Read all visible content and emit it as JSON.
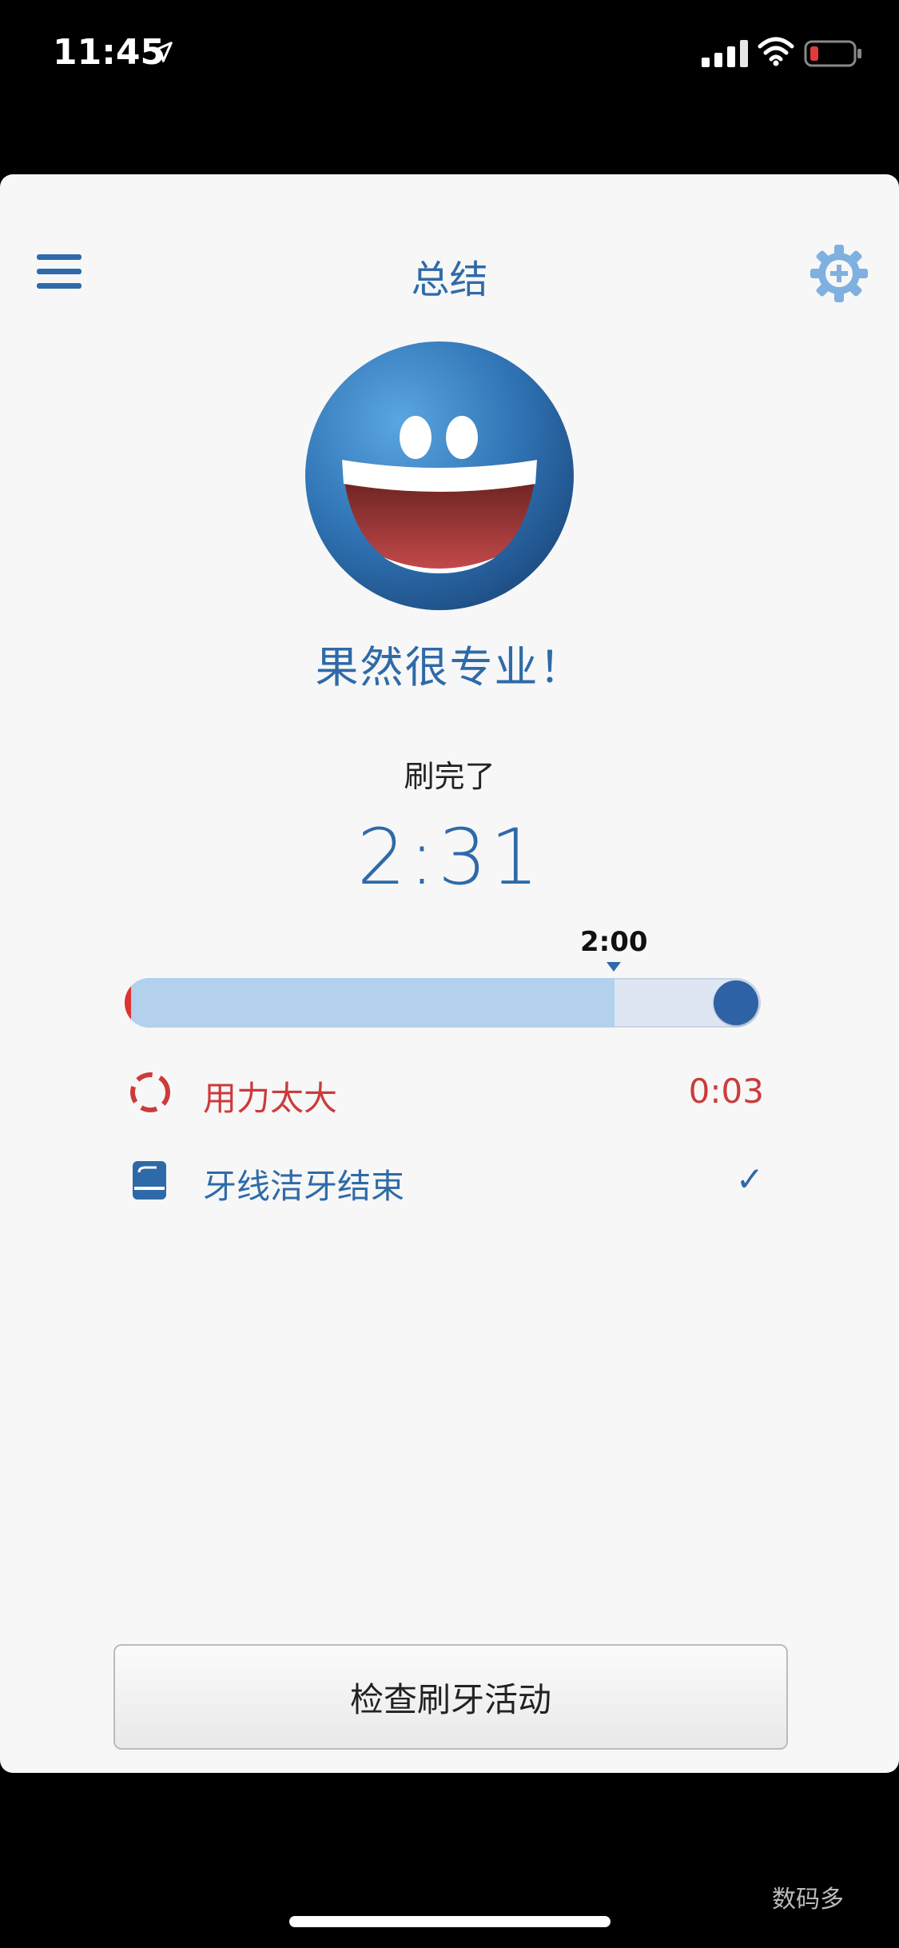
{
  "status_bar": {
    "time": "11:45"
  },
  "header": {
    "title": "总结"
  },
  "summary": {
    "tagline": "果然很专业！",
    "done_label": "刷完了",
    "duration": "2:31",
    "target_label": "2:00",
    "progress_fraction": 0.77,
    "target_fraction": 0.77
  },
  "rows": {
    "pressure": {
      "label": "用力太大",
      "value": "0:03"
    },
    "floss": {
      "label": "牙线洁牙结束",
      "value": "✓"
    }
  },
  "footer": {
    "button_label": "检查刷牙活动"
  },
  "watermark": "数码多",
  "colors": {
    "accent": "#2f6aa8",
    "warning": "#cc3b3b",
    "card_bg": "#f7f7f7"
  },
  "icons": [
    "location-arrow-icon",
    "signal-icon",
    "wifi-icon",
    "battery-icon",
    "menu-icon",
    "settings-gear-icon",
    "smiley-face-icon",
    "pressure-ring-icon",
    "floss-icon",
    "checkmark-icon"
  ]
}
